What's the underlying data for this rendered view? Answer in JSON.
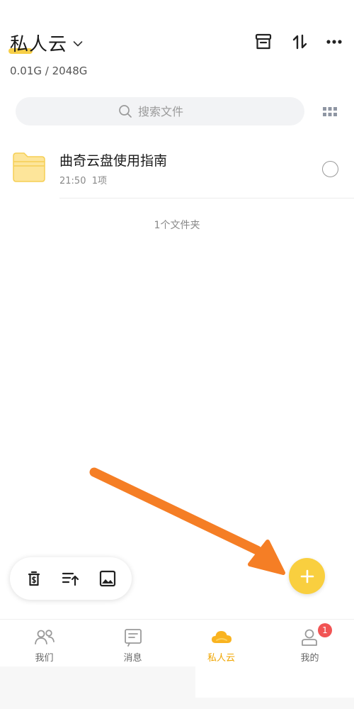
{
  "header": {
    "title": "私人云",
    "storage": "0.01G / 2048G",
    "icons": [
      "store-icon",
      "sort-icon",
      "more-icon"
    ]
  },
  "search": {
    "placeholder": "搜索文件"
  },
  "files": [
    {
      "name": "曲奇云盘使用指南",
      "time": "21:50",
      "count": "1项",
      "icon": "folder-icon"
    }
  ],
  "list_footer": "1个文件夹",
  "toolbar": {
    "icons": [
      "recycle-bin-icon",
      "upload-sort-icon",
      "image-icon"
    ]
  },
  "fab": {
    "icon": "plus-icon"
  },
  "nav": {
    "items": [
      {
        "label": "我们",
        "icon": "people-icon"
      },
      {
        "label": "消息",
        "icon": "message-icon"
      },
      {
        "label": "私人云",
        "icon": "cloud-icon",
        "active": true
      },
      {
        "label": "我的",
        "icon": "user-icon",
        "badge": "1"
      }
    ]
  },
  "colors": {
    "accent": "#f9cf3f",
    "active_label": "#f0a500",
    "badge": "#f15454",
    "annotation_arrow": "#f57e25"
  }
}
